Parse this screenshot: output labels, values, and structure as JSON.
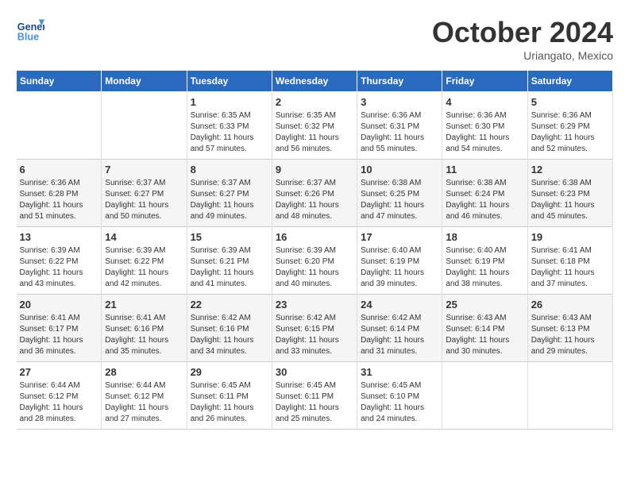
{
  "header": {
    "logo_line1": "General",
    "logo_line2": "Blue",
    "month": "October 2024",
    "location": "Uriangato, Mexico"
  },
  "days_of_week": [
    "Sunday",
    "Monday",
    "Tuesday",
    "Wednesday",
    "Thursday",
    "Friday",
    "Saturday"
  ],
  "weeks": [
    [
      {
        "day": "",
        "info": ""
      },
      {
        "day": "",
        "info": ""
      },
      {
        "day": "1",
        "info": "Sunrise: 6:35 AM\nSunset: 6:33 PM\nDaylight: 11 hours and 57 minutes."
      },
      {
        "day": "2",
        "info": "Sunrise: 6:35 AM\nSunset: 6:32 PM\nDaylight: 11 hours and 56 minutes."
      },
      {
        "day": "3",
        "info": "Sunrise: 6:36 AM\nSunset: 6:31 PM\nDaylight: 11 hours and 55 minutes."
      },
      {
        "day": "4",
        "info": "Sunrise: 6:36 AM\nSunset: 6:30 PM\nDaylight: 11 hours and 54 minutes."
      },
      {
        "day": "5",
        "info": "Sunrise: 6:36 AM\nSunset: 6:29 PM\nDaylight: 11 hours and 52 minutes."
      }
    ],
    [
      {
        "day": "6",
        "info": "Sunrise: 6:36 AM\nSunset: 6:28 PM\nDaylight: 11 hours and 51 minutes."
      },
      {
        "day": "7",
        "info": "Sunrise: 6:37 AM\nSunset: 6:27 PM\nDaylight: 11 hours and 50 minutes."
      },
      {
        "day": "8",
        "info": "Sunrise: 6:37 AM\nSunset: 6:27 PM\nDaylight: 11 hours and 49 minutes."
      },
      {
        "day": "9",
        "info": "Sunrise: 6:37 AM\nSunset: 6:26 PM\nDaylight: 11 hours and 48 minutes."
      },
      {
        "day": "10",
        "info": "Sunrise: 6:38 AM\nSunset: 6:25 PM\nDaylight: 11 hours and 47 minutes."
      },
      {
        "day": "11",
        "info": "Sunrise: 6:38 AM\nSunset: 6:24 PM\nDaylight: 11 hours and 46 minutes."
      },
      {
        "day": "12",
        "info": "Sunrise: 6:38 AM\nSunset: 6:23 PM\nDaylight: 11 hours and 45 minutes."
      }
    ],
    [
      {
        "day": "13",
        "info": "Sunrise: 6:39 AM\nSunset: 6:22 PM\nDaylight: 11 hours and 43 minutes."
      },
      {
        "day": "14",
        "info": "Sunrise: 6:39 AM\nSunset: 6:22 PM\nDaylight: 11 hours and 42 minutes."
      },
      {
        "day": "15",
        "info": "Sunrise: 6:39 AM\nSunset: 6:21 PM\nDaylight: 11 hours and 41 minutes."
      },
      {
        "day": "16",
        "info": "Sunrise: 6:39 AM\nSunset: 6:20 PM\nDaylight: 11 hours and 40 minutes."
      },
      {
        "day": "17",
        "info": "Sunrise: 6:40 AM\nSunset: 6:19 PM\nDaylight: 11 hours and 39 minutes."
      },
      {
        "day": "18",
        "info": "Sunrise: 6:40 AM\nSunset: 6:19 PM\nDaylight: 11 hours and 38 minutes."
      },
      {
        "day": "19",
        "info": "Sunrise: 6:41 AM\nSunset: 6:18 PM\nDaylight: 11 hours and 37 minutes."
      }
    ],
    [
      {
        "day": "20",
        "info": "Sunrise: 6:41 AM\nSunset: 6:17 PM\nDaylight: 11 hours and 36 minutes."
      },
      {
        "day": "21",
        "info": "Sunrise: 6:41 AM\nSunset: 6:16 PM\nDaylight: 11 hours and 35 minutes."
      },
      {
        "day": "22",
        "info": "Sunrise: 6:42 AM\nSunset: 6:16 PM\nDaylight: 11 hours and 34 minutes."
      },
      {
        "day": "23",
        "info": "Sunrise: 6:42 AM\nSunset: 6:15 PM\nDaylight: 11 hours and 33 minutes."
      },
      {
        "day": "24",
        "info": "Sunrise: 6:42 AM\nSunset: 6:14 PM\nDaylight: 11 hours and 31 minutes."
      },
      {
        "day": "25",
        "info": "Sunrise: 6:43 AM\nSunset: 6:14 PM\nDaylight: 11 hours and 30 minutes."
      },
      {
        "day": "26",
        "info": "Sunrise: 6:43 AM\nSunset: 6:13 PM\nDaylight: 11 hours and 29 minutes."
      }
    ],
    [
      {
        "day": "27",
        "info": "Sunrise: 6:44 AM\nSunset: 6:12 PM\nDaylight: 11 hours and 28 minutes."
      },
      {
        "day": "28",
        "info": "Sunrise: 6:44 AM\nSunset: 6:12 PM\nDaylight: 11 hours and 27 minutes."
      },
      {
        "day": "29",
        "info": "Sunrise: 6:45 AM\nSunset: 6:11 PM\nDaylight: 11 hours and 26 minutes."
      },
      {
        "day": "30",
        "info": "Sunrise: 6:45 AM\nSunset: 6:11 PM\nDaylight: 11 hours and 25 minutes."
      },
      {
        "day": "31",
        "info": "Sunrise: 6:45 AM\nSunset: 6:10 PM\nDaylight: 11 hours and 24 minutes."
      },
      {
        "day": "",
        "info": ""
      },
      {
        "day": "",
        "info": ""
      }
    ]
  ]
}
